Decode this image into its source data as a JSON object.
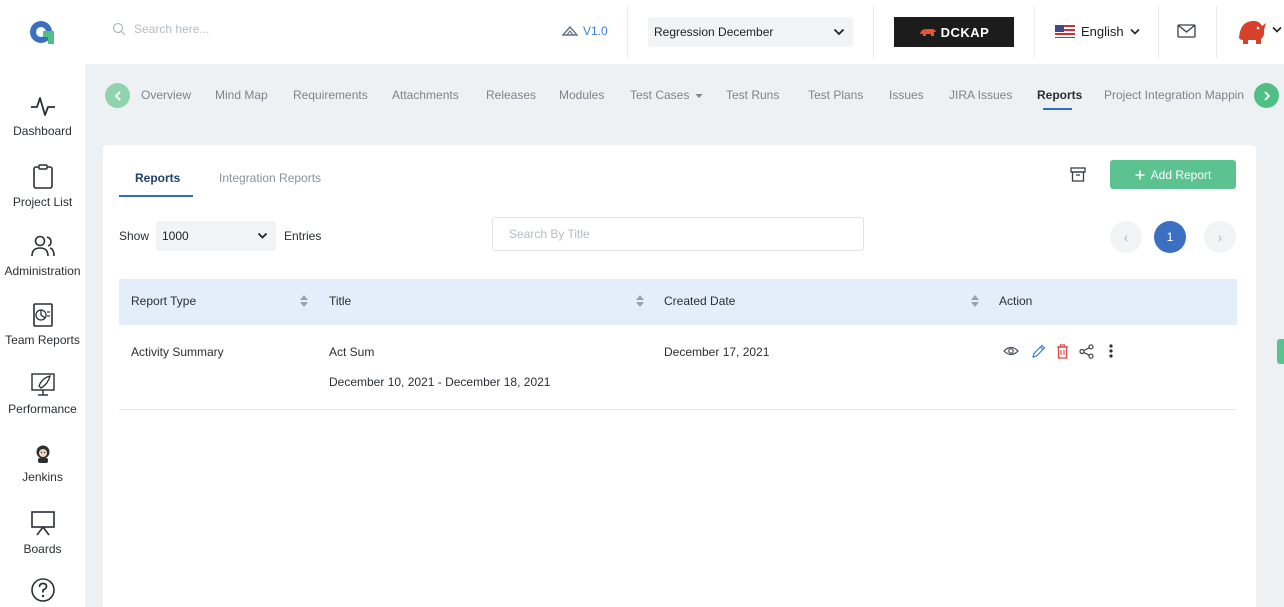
{
  "header": {
    "search_placeholder": "Search here...",
    "version": "V1.0",
    "project": "Regression December",
    "brand": "DCKAP",
    "language": "English"
  },
  "sidebar": {
    "items": [
      {
        "label": "Dashboard",
        "icon": "pulse-icon"
      },
      {
        "label": "Project List",
        "icon": "clipboard-icon"
      },
      {
        "label": "Administration",
        "icon": "users-icon"
      },
      {
        "label": "Team Reports",
        "icon": "report-icon"
      },
      {
        "label": "Performance",
        "icon": "rocket-icon"
      },
      {
        "label": "Jenkins",
        "icon": "jenkins-icon"
      },
      {
        "label": "Boards",
        "icon": "board-icon"
      },
      {
        "label": "",
        "icon": "help-icon"
      }
    ]
  },
  "modules": {
    "tabs": [
      {
        "label": "Overview"
      },
      {
        "label": "Mind Map"
      },
      {
        "label": "Requirements"
      },
      {
        "label": "Attachments"
      },
      {
        "label": "Releases"
      },
      {
        "label": "Modules"
      },
      {
        "label": "Test Cases"
      },
      {
        "label": "Test Runs"
      },
      {
        "label": "Test Plans"
      },
      {
        "label": "Issues"
      },
      {
        "label": "JIRA Issues"
      },
      {
        "label": "Reports"
      },
      {
        "label": "Project Integration Mappin"
      }
    ],
    "active": "Reports"
  },
  "content": {
    "tabs": [
      "Reports",
      "Integration Reports"
    ],
    "add_button": "Add Report",
    "show_label": "Show",
    "entries_value": "1000",
    "entries_label": "Entries",
    "title_search_placeholder": "Search By Title",
    "current_page": "1"
  },
  "table": {
    "columns": [
      "Report Type",
      "Title",
      "Created Date",
      "Action"
    ],
    "rows": [
      {
        "report_type": "Activity Summary",
        "title": "Act Sum",
        "date_range": "December 10, 2021 - December 18, 2021",
        "created_date": "December 17, 2021"
      }
    ]
  },
  "colors": {
    "accent": "#5cc28f",
    "primary": "#3b6fc0",
    "table_header": "#e3eefa",
    "danger": "#e04848"
  }
}
